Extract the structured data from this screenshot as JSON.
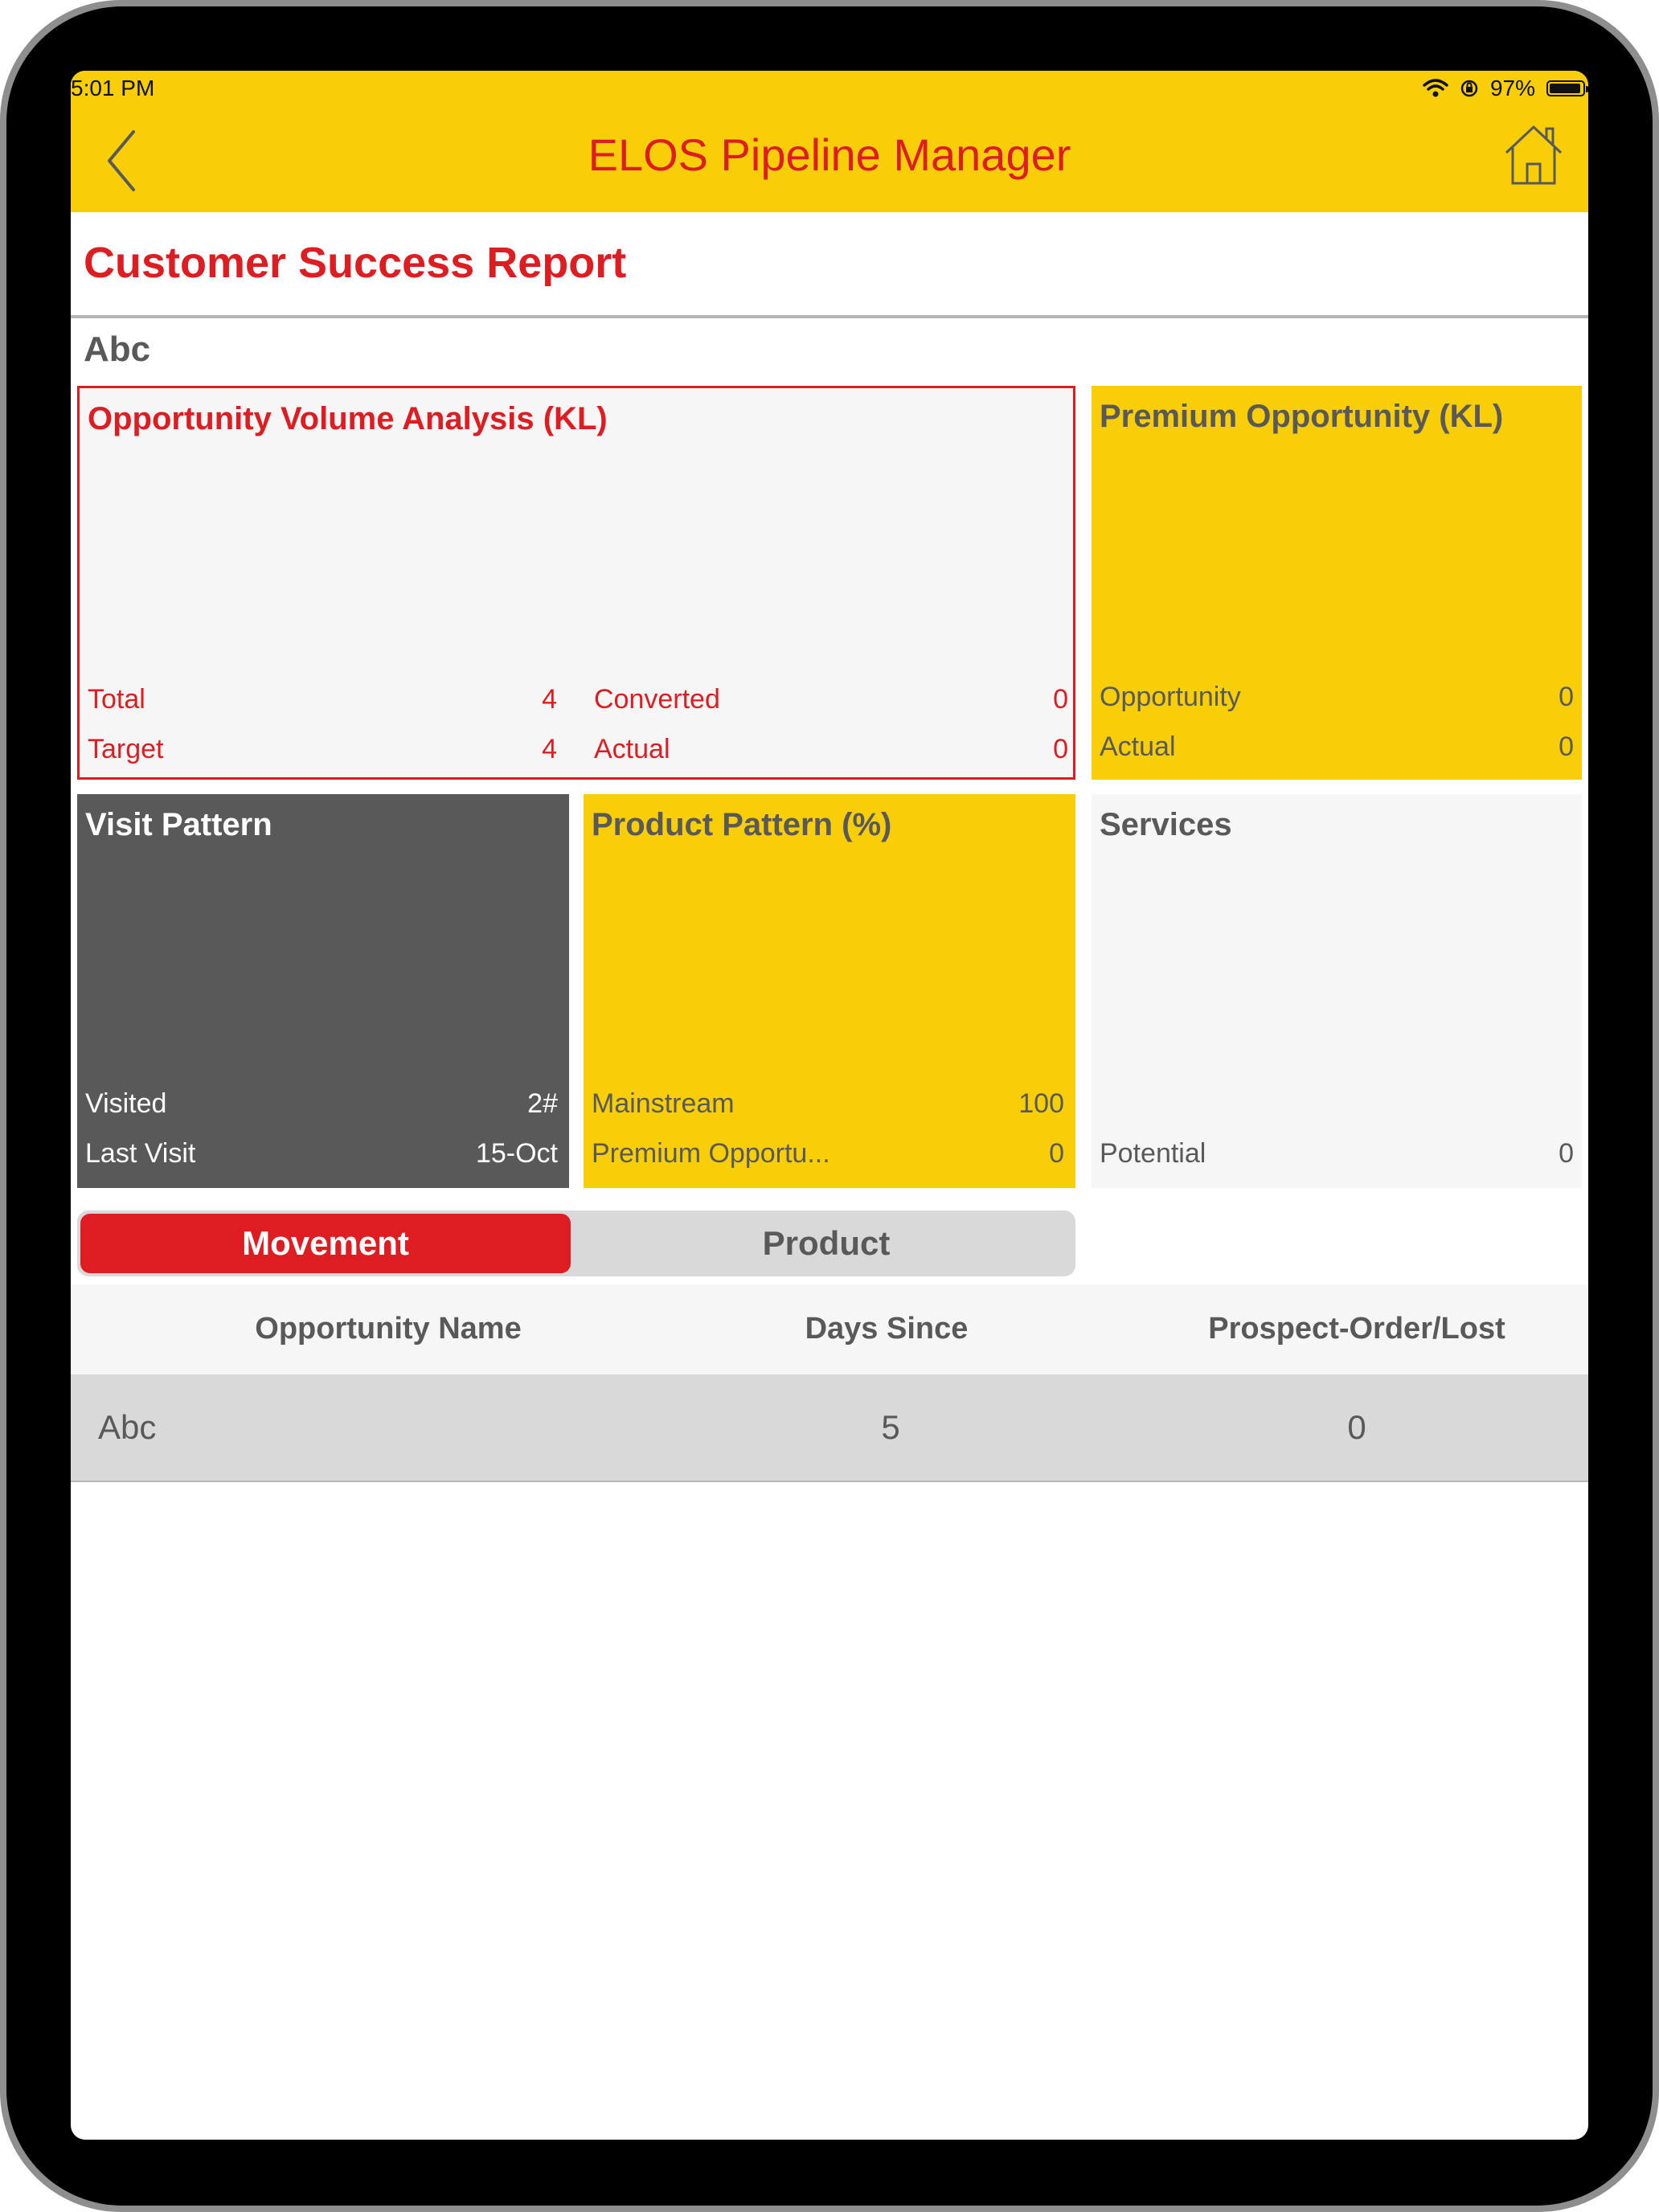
{
  "status_bar": {
    "time": "5:01 PM",
    "battery": "97%",
    "battery_level": 0.97
  },
  "nav": {
    "title": "ELOS Pipeline Manager",
    "back_icon": "chevron-left-icon",
    "home_icon": "home-icon"
  },
  "page": {
    "title": "Customer Success Report",
    "customer_name": "Abc"
  },
  "cards": {
    "volume": {
      "title": "Opportunity Volume Analysis (KL)",
      "total_label": "Total",
      "total_value": "4",
      "converted_label": "Converted",
      "converted_value": "0",
      "target_label": "Target",
      "target_value": "4",
      "actual_label": "Actual",
      "actual_value": "0"
    },
    "premium": {
      "title": "Premium Opportunity (KL)",
      "opportunity_label": "Opportunity",
      "opportunity_value": "0",
      "actual_label": "Actual",
      "actual_value": "0"
    },
    "visit": {
      "title": "Visit Pattern",
      "visited_label": "Visited",
      "visited_value": "2#",
      "last_visit_label": "Last Visit",
      "last_visit_value": "15-Oct"
    },
    "product": {
      "title": "Product Pattern (%)",
      "mainstream_label": "Mainstream",
      "mainstream_value": "100",
      "premium_label": "Premium Opportu...",
      "premium_value": "0"
    },
    "services": {
      "title": "Services",
      "potential_label": "Potential",
      "potential_value": "0"
    }
  },
  "segmented": {
    "selected": "Movement",
    "options": [
      "Movement",
      "Product"
    ]
  },
  "table": {
    "columns": [
      "Opportunity Name",
      "Days Since",
      "Prospect-Order/Lost"
    ],
    "rows": [
      [
        "Abc",
        "5",
        "0"
      ]
    ]
  },
  "colors": {
    "brand_yellow": "#f7ce08",
    "brand_red": "#dd1d21",
    "dark_gray": "#595959",
    "light_gray": "#f6f6f6"
  }
}
